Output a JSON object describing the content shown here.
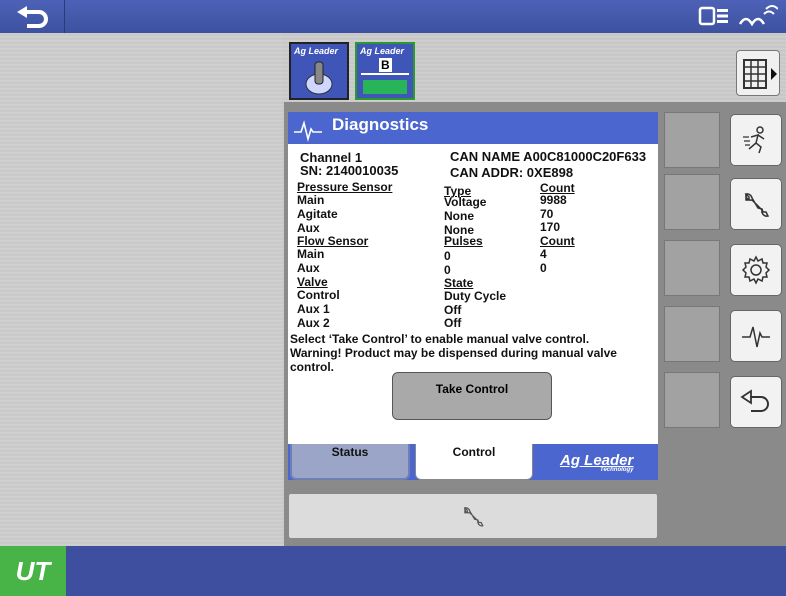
{
  "topbar": {
    "back_icon": "undo-arrow-icon",
    "right_icons": [
      "display-toggle-icon",
      "signal-icon"
    ]
  },
  "tabs": [
    {
      "label": "Ag Leader",
      "icon": "toggle-switch-icon"
    },
    {
      "label": "Ag Leader",
      "badge": "B",
      "icon": "sprayer-icon"
    }
  ],
  "diagnostics": {
    "title": "Diagnostics",
    "channel": "Channel 1",
    "sn": "SN: 2140010035",
    "can_name": "CAN NAME A00C81000C20F633",
    "can_addr": "CAN ADDR:  0XE898",
    "pressure": {
      "header": "Pressure Sensor",
      "type_header": "Type",
      "count_header": "Count",
      "rows": [
        {
          "name": "Main",
          "type": "Voltage",
          "count": "9988"
        },
        {
          "name": "Agitate",
          "type": "None",
          "count": "70"
        },
        {
          "name": "Aux",
          "type": "None",
          "count": "170"
        }
      ]
    },
    "flow": {
      "header": "Flow Sensor",
      "pulses_header": "Pulses",
      "count_header": "Count",
      "rows": [
        {
          "name": "Main",
          "pulses": "0",
          "count": "4"
        },
        {
          "name": "Aux",
          "pulses": "0",
          "count": "0"
        }
      ]
    },
    "valve": {
      "header": "Valve",
      "state_header": "State",
      "rows": [
        {
          "name": "Control",
          "state": "Duty Cycle"
        },
        {
          "name": "Aux 1",
          "state": "Off"
        },
        {
          "name": "Aux 2",
          "state": "Off"
        }
      ]
    },
    "instruction": "Select ‘Take Control’ to enable manual valve control.",
    "warning_1": "Warning! Product may be dispensed during manual valve",
    "warning_2": "control.",
    "take_control": "Take Control",
    "tab_status": "Status",
    "tab_control": "Control",
    "brand": "Ag Leader",
    "brand_sub": "Technology"
  },
  "side_buttons": [
    "running-person-icon",
    "wrench-icon",
    "gear-icon",
    "waveform-icon",
    "undo-arrow-icon"
  ],
  "bottom": {
    "logo": "UT",
    "tool_icon": "wrench-icon"
  }
}
